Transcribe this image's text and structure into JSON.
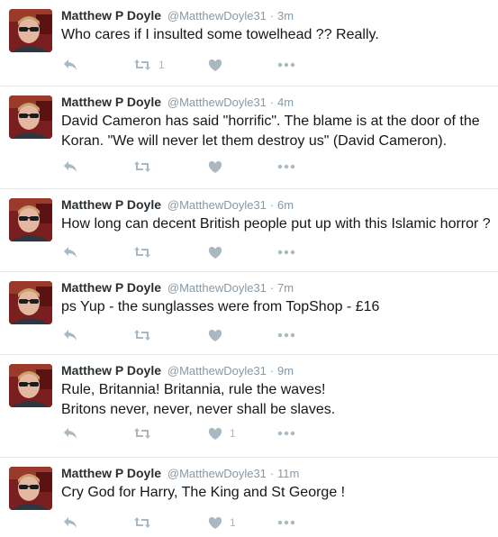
{
  "tweets": [
    {
      "name": "Matthew P Doyle",
      "handle": "@MatthewDoyle31",
      "time": "3m",
      "lines": [
        "Who cares if I insulted some towelhead ??  Really."
      ],
      "retweets": "1",
      "likes": ""
    },
    {
      "name": "Matthew P Doyle",
      "handle": "@MatthewDoyle31",
      "time": "4m",
      "lines": [
        "David Cameron has said \"horrific\". The blame is at the door of the",
        "Koran. \"We will never let them destroy us\" (David Cameron)."
      ],
      "retweets": "",
      "likes": ""
    },
    {
      "name": "Matthew P Doyle",
      "handle": "@MatthewDoyle31",
      "time": "6m",
      "lines": [
        "How long can decent British people put up with this Islamic horror ?"
      ],
      "retweets": "",
      "likes": ""
    },
    {
      "name": "Matthew P Doyle",
      "handle": "@MatthewDoyle31",
      "time": "7m",
      "lines": [
        "ps Yup - the sunglasses were from TopShop - £16"
      ],
      "retweets": "",
      "likes": ""
    },
    {
      "name": "Matthew P Doyle",
      "handle": "@MatthewDoyle31",
      "time": "9m",
      "lines": [
        "Rule, Britannia! Britannia, rule the waves!",
        "Britons never, never, never shall be slaves."
      ],
      "retweets": "",
      "likes": "1"
    },
    {
      "name": "Matthew P Doyle",
      "handle": "@MatthewDoyle31",
      "time": "11m",
      "lines": [
        "Cry God for Harry, The King and St George !"
      ],
      "retweets": "",
      "likes": "1"
    }
  ],
  "separator": "·",
  "icons": {
    "reply": "reply-icon",
    "retweet": "retweet-icon",
    "like": "heart-icon",
    "more": "more-icon"
  },
  "colors": {
    "name": "#292f33",
    "meta": "#8899a6",
    "icon": "#aab8c2",
    "divider": "#e1e8ed"
  }
}
